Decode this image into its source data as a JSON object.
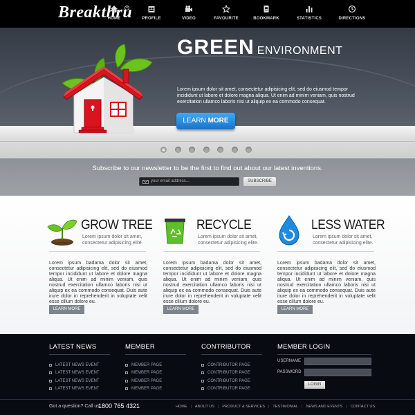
{
  "header": {
    "logo": "Breakthru",
    "logo_mark": "R",
    "nav": [
      {
        "label": "HOME",
        "icon": "home-icon"
      },
      {
        "label": "PROFILE",
        "icon": "profile-icon"
      },
      {
        "label": "VIDEO",
        "icon": "video-icon"
      },
      {
        "label": "FAVOURITE",
        "icon": "star-icon"
      },
      {
        "label": "BOOKMARK",
        "icon": "bookmark-icon"
      },
      {
        "label": "STATISTICS",
        "icon": "statistics-icon"
      },
      {
        "label": "DIRECTIONS",
        "icon": "compass-icon"
      }
    ]
  },
  "hero": {
    "title_big": "GREEN",
    "title_small": "ENVIRONMENT",
    "text": "Lorem ipsum dolor sit amet, consectetur adipisicing elit, sed do eiusmod tempor incididunt ut labore et dolore magna aliqua. Ut enim ad minim veniam, quis nostrud exercitation ullamco laboris nisi ut aliquip ex ea commodo consequat.",
    "button_light": "LEARN",
    "button_bold": "MORE",
    "slides": 7,
    "active_slide": 1
  },
  "newsletter": {
    "text": "Subscribe to our newsletter to be the first to find out about our latest inventions.",
    "placeholder": "your email address...",
    "button": "SUBSCRIBE"
  },
  "features": [
    {
      "title": "GROW TREE",
      "icon": "sprout-icon",
      "subtitle": "Lorem ipsum dolor sit amet, consectetur adipisicing elite.",
      "body": "Lorem ipsum badama dolor sit amet, consectetur adipisicing elit, sed do eiusmod tempor incididunt ut labore et dolore magna aliqua. Ut enim ad minim veniam, quis nostrud exercitation ullamco laboris nisi ut aliquip ex ea commodo consequat. Duis aute irure dolor in reprehenderit in voluptate velit esse cillum dolore eu.",
      "button": "LEARN MORE"
    },
    {
      "title": "RECYCLE",
      "icon": "recycle-bin-icon",
      "subtitle": "Lorem ipsum dolor sit amet, consectetur adipisicing elite.",
      "body": "Lorem ipsum badama dolor sit amet, consectetur adipisicing elit, sed do eiusmod tempor incididunt ut labore et dolore magna aliqua. Ut enim ad minim veniam, quis nostrud exercitation ullamco laboris nisi ut aliquip ex ea commodo consequat. Duis aute irure dolor in reprehenderit in voluptate velit esse cillum dolore eu.",
      "button": "LEARN MORE"
    },
    {
      "title": "LESS WATER",
      "icon": "water-drop-icon",
      "subtitle": "Lorem ipsum dolor sit amet, consectetur adipisicing elite.",
      "body": "Lorem ipsum badama dolor sit amet, consectetur adipisicing elit, sed do eiusmod tempor incididunt ut labore et dolore magna aliqua. Ut enim ad minim veniam, quis nostrud exercitation ullamco laboris nisi ut aliquip ex ea commodo consequat. Duis aute irure dolor in reprehenderit in voluptate velit esse cillum dolore eu.",
      "button": "LEARN MORE"
    }
  ],
  "footer": {
    "columns": [
      {
        "heading": "LATEST NEWS",
        "items": [
          "LATEST NEWS EVENT",
          "LATEST NEWS EVENT",
          "LATEST NEWS EVENT",
          "LATEST NEWS EVENT"
        ]
      },
      {
        "heading": "MEMBER",
        "items": [
          "MEMBER PAGE",
          "MEMBER PAGE",
          "MEMBER PAGE",
          "MEMBER PAGE"
        ]
      },
      {
        "heading": "CONTRIBUTOR",
        "items": [
          "CONTRIBUTOR PAGE",
          "CONTRIBUTOR PAGE",
          "CONTRIBUTOR PAGE",
          "CONTRIBUTOR PAGE"
        ]
      }
    ],
    "login": {
      "heading": "MEMBER LOGIN",
      "username_label": "USERNAME",
      "password_label": "PASSWORD",
      "button": "LOGIN"
    },
    "question": "Got a question? Call us",
    "phone": "1800 765 4321",
    "links": [
      "HOME",
      "ABOUT US",
      "PRODUCT & SERVICES",
      "TESTIMONIAL",
      "NEWS AND EVENTS",
      "CONTACT US"
    ]
  },
  "colors": {
    "accent_blue": "#1a8be0",
    "hero_bg": "#404852",
    "footer_bg": "#080b12",
    "house_roof": "#d8141f",
    "leaf_green": "#5fb81b"
  }
}
